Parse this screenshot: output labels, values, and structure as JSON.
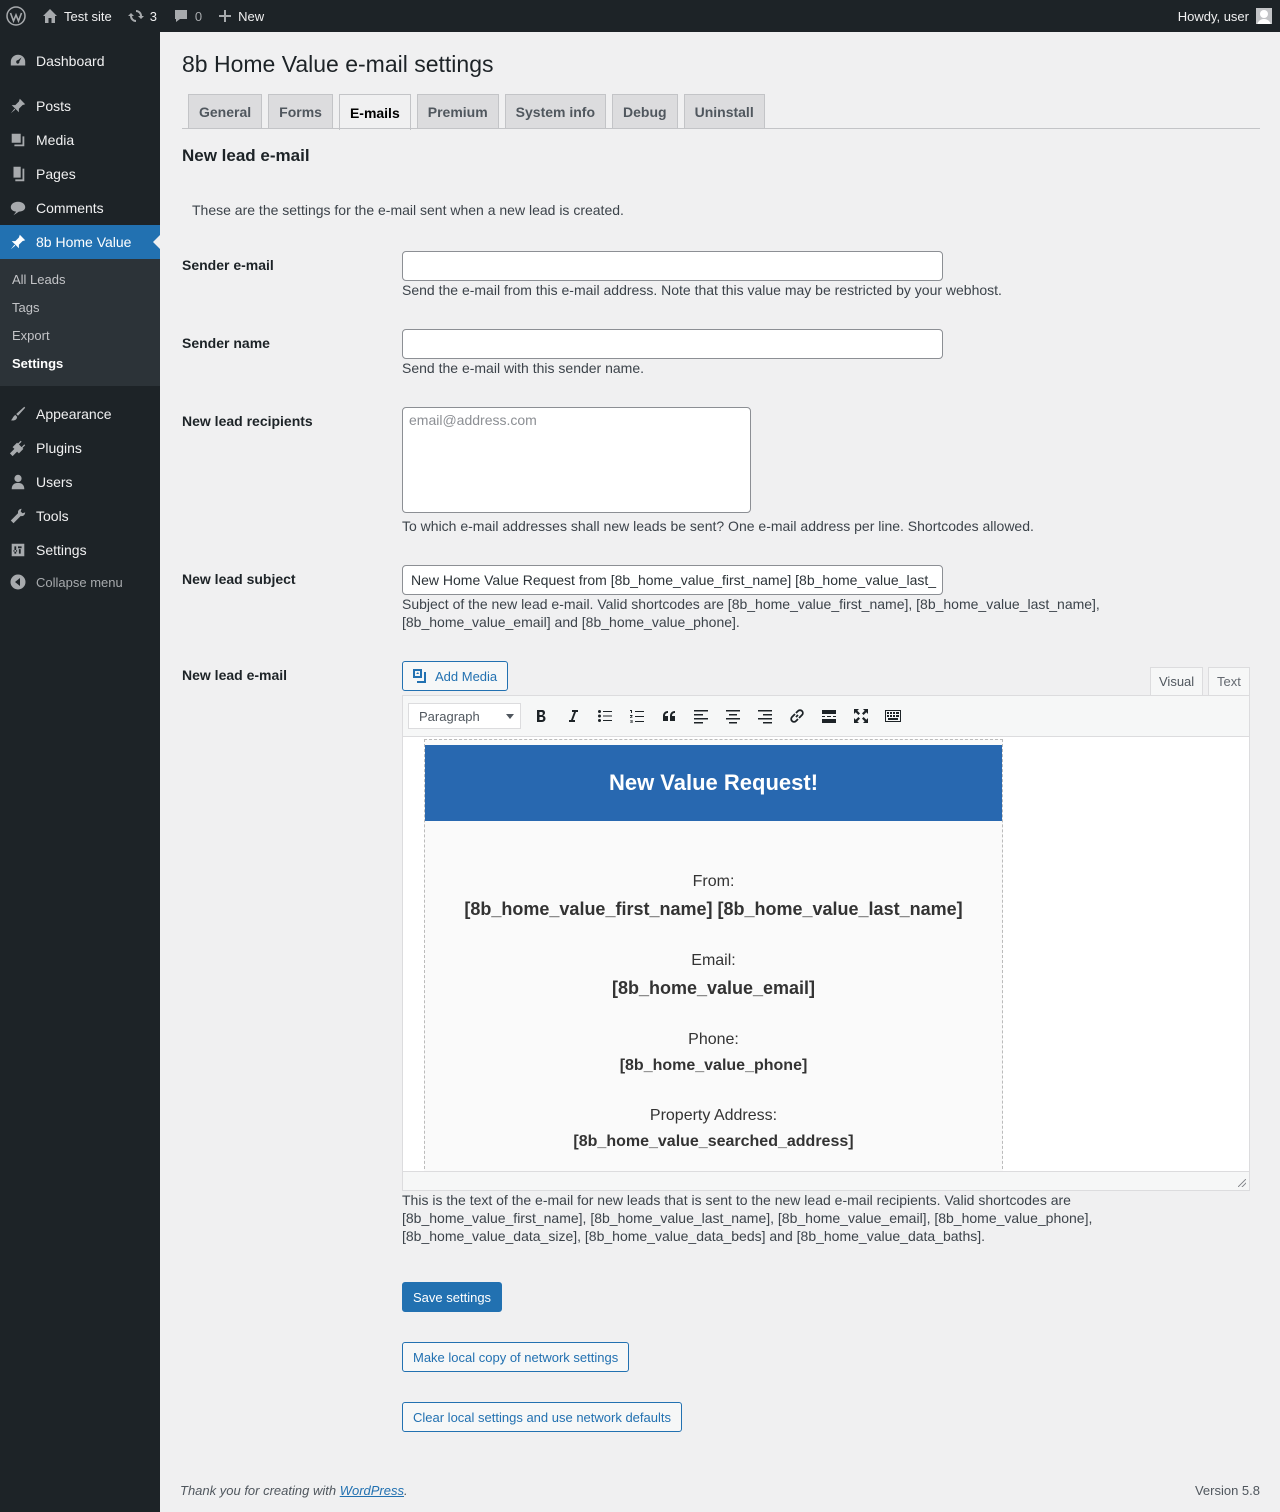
{
  "adminbar": {
    "site_name": "Test site",
    "updates_count": "3",
    "comments_count": "0",
    "new_label": "New",
    "howdy": "Howdy, user"
  },
  "sidebar": {
    "items": [
      {
        "label": "Dashboard",
        "icon": "dashboard-icon"
      },
      {
        "label": "Posts",
        "icon": "pin-icon"
      },
      {
        "label": "Media",
        "icon": "media-icon"
      },
      {
        "label": "Pages",
        "icon": "pages-icon"
      },
      {
        "label": "Comments",
        "icon": "comment-icon"
      },
      {
        "label": "8b Home Value",
        "icon": "pin-icon",
        "current": true
      },
      {
        "label": "Appearance",
        "icon": "brush-icon"
      },
      {
        "label": "Plugins",
        "icon": "plugin-icon"
      },
      {
        "label": "Users",
        "icon": "user-icon"
      },
      {
        "label": "Tools",
        "icon": "wrench-icon"
      },
      {
        "label": "Settings",
        "icon": "settings-icon"
      }
    ],
    "submenu": [
      "All Leads",
      "Tags",
      "Export",
      "Settings"
    ],
    "collapse_label": "Collapse menu"
  },
  "page": {
    "title": "8b Home Value e-mail settings",
    "tabs": [
      "General",
      "Forms",
      "E-mails",
      "Premium",
      "System info",
      "Debug",
      "Uninstall"
    ],
    "active_tab": "E-mails",
    "section_title": "New lead e-mail",
    "section_desc": "These are the settings for the e-mail sent when a new lead is created."
  },
  "form": {
    "sender_email": {
      "label": "Sender e-mail",
      "value": "",
      "help": "Send the e-mail from this e-mail address. Note that this value may be restricted by your webhost."
    },
    "sender_name": {
      "label": "Sender name",
      "value": "",
      "help": "Send the e-mail with this sender name."
    },
    "recipients": {
      "label": "New lead recipients",
      "placeholder": "email@address.com",
      "help": "To which e-mail addresses shall new leads be sent? One e-mail address per line. Shortcodes allowed."
    },
    "subject": {
      "label": "New lead subject",
      "value": "New Home Value Request from [8b_home_value_first_name] [8b_home_value_last_",
      "help_line1": "Subject of the new lead e-mail. Valid shortcodes are [8b_home_value_first_name], [8b_home_value_last_name],",
      "help_line2": "[8b_home_value_email] and [8b_home_value_phone]."
    },
    "email_body": {
      "label": "New lead e-mail",
      "add_media": "Add Media",
      "tab_visual": "Visual",
      "tab_text": "Text",
      "format_select": "Paragraph",
      "heading": "New Value Request!",
      "from_label": "From:",
      "from_value": "[8b_home_value_first_name] [8b_home_value_last_name]",
      "email_label": "Email:",
      "email_value": "[8b_home_value_email]",
      "phone_label": "Phone:",
      "phone_value": "[8b_home_value_phone]",
      "address_label": "Property Address:",
      "address_value": "[8b_home_value_searched_address]",
      "help_line1": "This is the text of the e-mail for new leads that is sent to the new lead e-mail recipients. Valid shortcodes are",
      "help_line2": "[8b_home_value_first_name], [8b_home_value_last_name], [8b_home_value_email], [8b_home_value_phone],",
      "help_line3": "[8b_home_value_data_size], [8b_home_value_data_beds] and [8b_home_value_data_baths]."
    }
  },
  "buttons": {
    "save": "Save settings",
    "local_copy": "Make local copy of network settings",
    "clear_local": "Clear local settings and use network defaults"
  },
  "footer": {
    "thanks_prefix": "Thank you for creating with ",
    "thanks_link": "WordPress",
    "thanks_suffix": ".",
    "version": "Version 5.8"
  },
  "colors": {
    "accent": "#2271b1",
    "email_header": "#2868b0",
    "sidebar_bg": "#1d2327"
  }
}
